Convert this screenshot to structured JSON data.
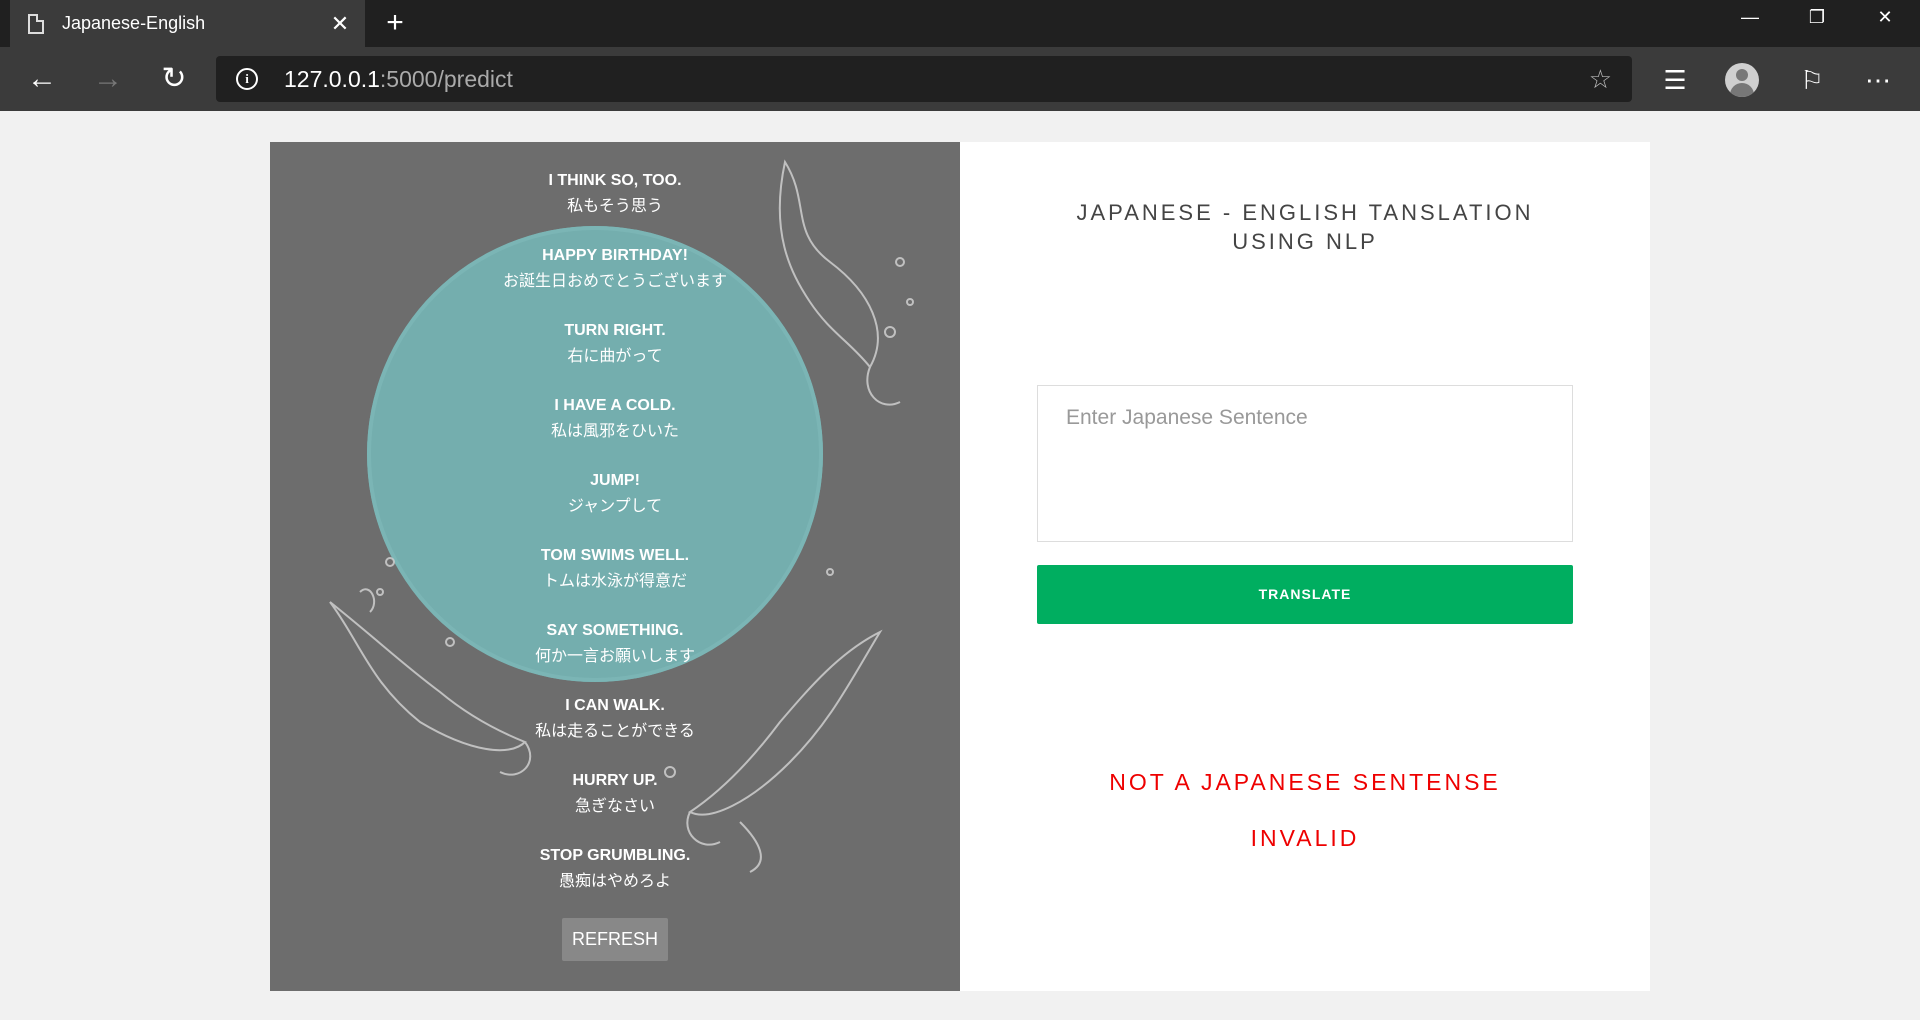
{
  "browser": {
    "tab_title": "Japanese-English",
    "tab_close": "✕",
    "new_tab": "+",
    "url_host": "127.0.0.1",
    "url_path": ":5000/predict",
    "win_minimize": "—",
    "win_restore": "❐",
    "win_close": "✕"
  },
  "left_panel": {
    "phrases": [
      {
        "en": "I THINK SO, TOO.",
        "ja": "私もそう思う"
      },
      {
        "en": "HAPPY BIRTHDAY!",
        "ja": "お誕生日おめでとうございます"
      },
      {
        "en": "TURN RIGHT.",
        "ja": "右に曲がって"
      },
      {
        "en": "I HAVE A COLD.",
        "ja": "私は風邪をひいた"
      },
      {
        "en": "JUMP!",
        "ja": "ジャンプして"
      },
      {
        "en": "TOM SWIMS WELL.",
        "ja": "トムは水泳が得意だ"
      },
      {
        "en": "SAY SOMETHING.",
        "ja": "何か一言お願いします"
      },
      {
        "en": "I CAN WALK.",
        "ja": "私は走ることができる"
      },
      {
        "en": "HURRY UP.",
        "ja": "急ぎなさい"
      },
      {
        "en": "STOP GRUMBLING.",
        "ja": "愚痴はやめろよ"
      }
    ],
    "refresh_label": "REFRESH"
  },
  "right_panel": {
    "heading_line1": "JAPANESE - ENGLISH TANSLATION",
    "heading_line2": "USING NLP",
    "input_placeholder": "Enter Japanese Sentence",
    "translate_label": "TRANSLATE",
    "result_message": "NOT A JAPANESE SENTENSE",
    "result_status": "INVALID"
  },
  "colors": {
    "accent_green": "#00ae60",
    "error_red": "#e00000",
    "panel_gray": "#6d6d6d",
    "moon_teal": "#74aeae"
  }
}
